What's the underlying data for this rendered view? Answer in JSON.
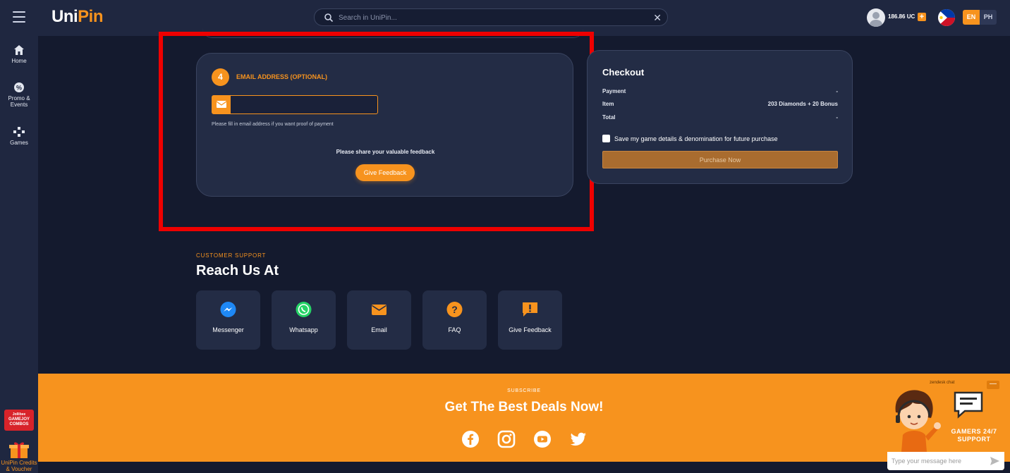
{
  "header": {
    "logo_main": "Uni",
    "logo_accent": "Pin",
    "search_placeholder": "Search in UniPin...",
    "balance": "186.86 UC",
    "lang_en": "EN",
    "lang_ph": "PH"
  },
  "sidebar": {
    "items": [
      {
        "label": "Home",
        "icon": "home-icon"
      },
      {
        "label": "Promo & Events",
        "icon": "promo-icon"
      },
      {
        "label": "Games",
        "icon": "gamepad-icon"
      }
    ],
    "gamejoy_badge_brand": "Jollibee",
    "gamejoy_badge": "GAMEJOY COMBOS",
    "credits_label": "UniPin Credits & Voucher"
  },
  "email_section": {
    "step_number": "4",
    "title": "EMAIL ADDRESS (OPTIONAL)",
    "input_value": "",
    "hint": "Please fill in email address if you want proof of payment",
    "feedback_prompt": "Please share your valuable feedback",
    "feedback_button": "Give Feedback"
  },
  "checkout": {
    "title": "Checkout",
    "rows": [
      {
        "label": "Payment",
        "value": "-"
      },
      {
        "label": "Item",
        "value": "203 Diamonds + 20 Bonus"
      },
      {
        "label": "Total",
        "value": "-"
      }
    ],
    "save_label": "Save my game details & denomination for future purchase",
    "purchase_button": "Purchase Now"
  },
  "support": {
    "label": "CUSTOMER SUPPORT",
    "title": "Reach Us At",
    "items": [
      {
        "label": "Messenger",
        "icon": "messenger-icon"
      },
      {
        "label": "Whatsapp",
        "icon": "whatsapp-icon"
      },
      {
        "label": "Email",
        "icon": "email-icon"
      },
      {
        "label": "FAQ",
        "icon": "faq-icon"
      },
      {
        "label": "Give Feedback",
        "icon": "feedback-icon"
      }
    ]
  },
  "subscribe": {
    "label": "SUBSCRIBE",
    "title": "Get The Best Deals Now!",
    "social": [
      "facebook-icon",
      "instagram-icon",
      "youtube-icon",
      "twitter-icon"
    ]
  },
  "chat": {
    "brand": "zendesk chat",
    "minimize": "—",
    "tagline": "GAMERS 24/7 SUPPORT",
    "placeholder": "Type your message here"
  },
  "colors": {
    "accent": "#f7931e",
    "background": "#141a2e",
    "panel": "#232c45",
    "highlight": "#ee0000"
  }
}
